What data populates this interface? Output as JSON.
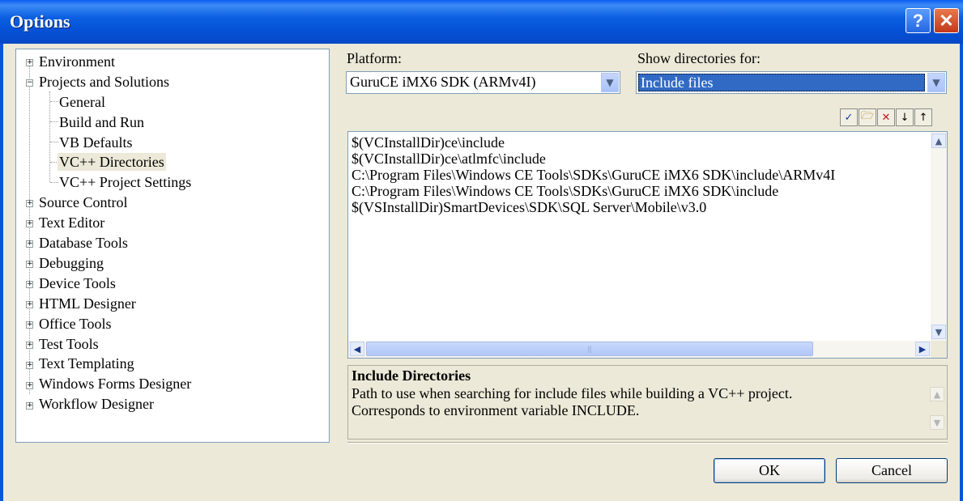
{
  "window": {
    "title": "Options",
    "help_glyph": "?",
    "close_glyph": "✕"
  },
  "tree": {
    "items": [
      {
        "label": "Environment",
        "expander": "+"
      },
      {
        "label": "Projects and Solutions",
        "expander": "−"
      },
      {
        "label": "General"
      },
      {
        "label": "Build and Run"
      },
      {
        "label": "VB Defaults"
      },
      {
        "label": "VC++ Directories",
        "selected": true
      },
      {
        "label": "VC++ Project Settings"
      },
      {
        "label": "Source Control",
        "expander": "+"
      },
      {
        "label": "Text Editor",
        "expander": "+"
      },
      {
        "label": "Database Tools",
        "expander": "+"
      },
      {
        "label": "Debugging",
        "expander": "+"
      },
      {
        "label": "Device Tools",
        "expander": "+"
      },
      {
        "label": "HTML Designer",
        "expander": "+"
      },
      {
        "label": "Office Tools",
        "expander": "+"
      },
      {
        "label": "Test Tools",
        "expander": "+"
      },
      {
        "label": "Text Templating",
        "expander": "+"
      },
      {
        "label": "Windows Forms Designer",
        "expander": "+"
      },
      {
        "label": "Workflow Designer",
        "expander": "+"
      }
    ]
  },
  "platform": {
    "label": "Platform:",
    "value": "GuruCE iMX6 SDK (ARMv4I)"
  },
  "show_dirs": {
    "label": "Show directories for:",
    "value": "Include files"
  },
  "toolbar": {
    "check": "✓",
    "new_folder": "🗁",
    "delete": "✕",
    "down": "↓",
    "up": "↑"
  },
  "directories": [
    "$(VCInstallDir)ce\\include",
    "$(VCInstallDir)ce\\atlmfc\\include",
    "C:\\Program Files\\Windows CE Tools\\SDKs\\GuruCE iMX6 SDK\\include\\ARMv4I",
    "C:\\Program Files\\Windows CE Tools\\SDKs\\GuruCE iMX6 SDK\\include",
    "$(VSInstallDir)SmartDevices\\SDK\\SQL Server\\Mobile\\v3.0"
  ],
  "description": {
    "title": "Include Directories",
    "line1": "Path to use when searching for include files while building a VC++ project.",
    "line2": "Corresponds to environment variable INCLUDE."
  },
  "buttons": {
    "ok": "OK",
    "cancel": "Cancel"
  }
}
